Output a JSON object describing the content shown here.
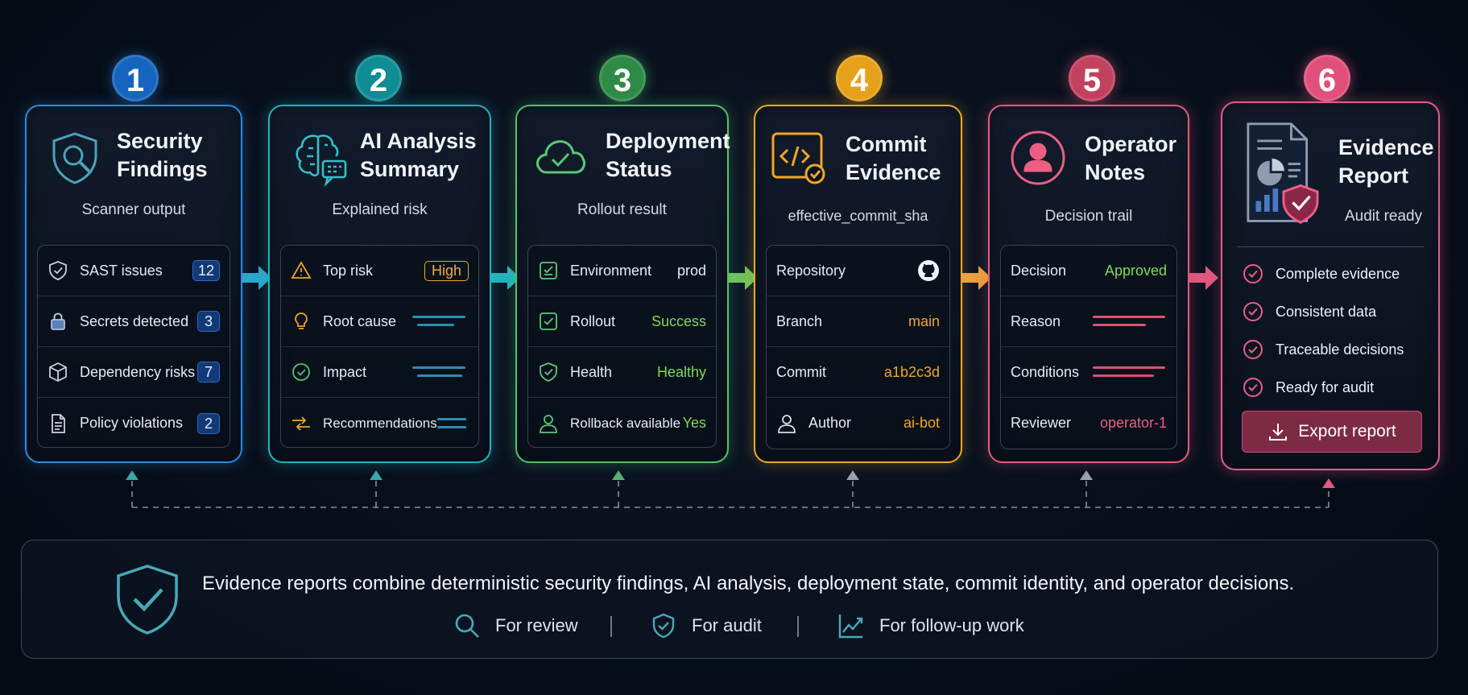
{
  "colors": {
    "step1": "#2d8be0",
    "step2": "#22b3bd",
    "step3": "#4fc36a",
    "step4": "#f0a826",
    "step5": "#e45c7c",
    "step6": "#e95a85",
    "text_green": "#7ed957",
    "text_orange": "#f2a623",
    "text_pink": "#ef5b82"
  },
  "steps": [
    {
      "number": "1",
      "title": "Security\nFindings",
      "subtitle": "Scanner output",
      "icon": "shield-search-icon",
      "rows": [
        {
          "icon": "shield-icon",
          "label": "SAST issues",
          "value": "12"
        },
        {
          "icon": "lock-icon",
          "label": "Secrets detected",
          "value": "3"
        },
        {
          "icon": "package-icon",
          "label": "Dependency risks",
          "value": "7"
        },
        {
          "icon": "document-icon",
          "label": "Policy violations",
          "value": "2"
        }
      ]
    },
    {
      "number": "2",
      "title": "AI Analysis\nSummary",
      "subtitle": "Explained risk",
      "icon": "brain-icon",
      "rows": [
        {
          "icon": "warning-icon",
          "label": "Top risk",
          "value": "High"
        },
        {
          "icon": "lightbulb-icon",
          "label": "Root cause",
          "value": ""
        },
        {
          "icon": "check-circle-icon",
          "label": "Impact",
          "value": ""
        },
        {
          "icon": "route-icon",
          "label": "Recommendations",
          "value": ""
        }
      ]
    },
    {
      "number": "3",
      "title": "Deployment\nStatus",
      "subtitle": "Rollout result",
      "icon": "cloud-check-icon",
      "rows": [
        {
          "icon": "environment-icon",
          "label": "Environment",
          "value": "prod"
        },
        {
          "icon": "checkbox-icon",
          "label": "Rollout",
          "value": "Success"
        },
        {
          "icon": "shield-check-icon",
          "label": "Health",
          "value": "Healthy"
        },
        {
          "icon": "user-icon",
          "label": "Rollback available",
          "value": "Yes"
        }
      ]
    },
    {
      "number": "4",
      "title": "Commit\nEvidence",
      "subtitle": "effective_commit_sha",
      "icon": "code-check-icon",
      "rows": [
        {
          "icon": "",
          "label": "Repository",
          "value": ""
        },
        {
          "icon": "",
          "label": "Branch",
          "value": "main"
        },
        {
          "icon": "",
          "label": "Commit",
          "value": "a1b2c3d"
        },
        {
          "icon": "user-icon",
          "label": "Author",
          "value": "ai-bot"
        }
      ]
    },
    {
      "number": "5",
      "title": "Operator\nNotes",
      "subtitle": "Decision trail",
      "icon": "operator-icon",
      "rows": [
        {
          "icon": "",
          "label": "Decision",
          "value": "Approved"
        },
        {
          "icon": "",
          "label": "Reason",
          "value": ""
        },
        {
          "icon": "",
          "label": "Conditions",
          "value": ""
        },
        {
          "icon": "",
          "label": "Reviewer",
          "value": "operator-1"
        }
      ]
    },
    {
      "number": "6",
      "title": "Evidence\nReport",
      "subtitle": "Audit ready",
      "icon": "report-icon",
      "checks": [
        "Complete evidence",
        "Consistent data",
        "Traceable decisions",
        "Ready for audit"
      ],
      "button": "Export report"
    }
  ],
  "footer": {
    "text": "Evidence reports combine deterministic security findings, AI analysis, deployment state, commit identity, and operator decisions.",
    "uses": [
      {
        "icon": "search-icon",
        "label": "For review"
      },
      {
        "icon": "shield-check-icon",
        "label": "For audit"
      },
      {
        "icon": "trend-chart-icon",
        "label": "For follow-up work"
      }
    ]
  }
}
